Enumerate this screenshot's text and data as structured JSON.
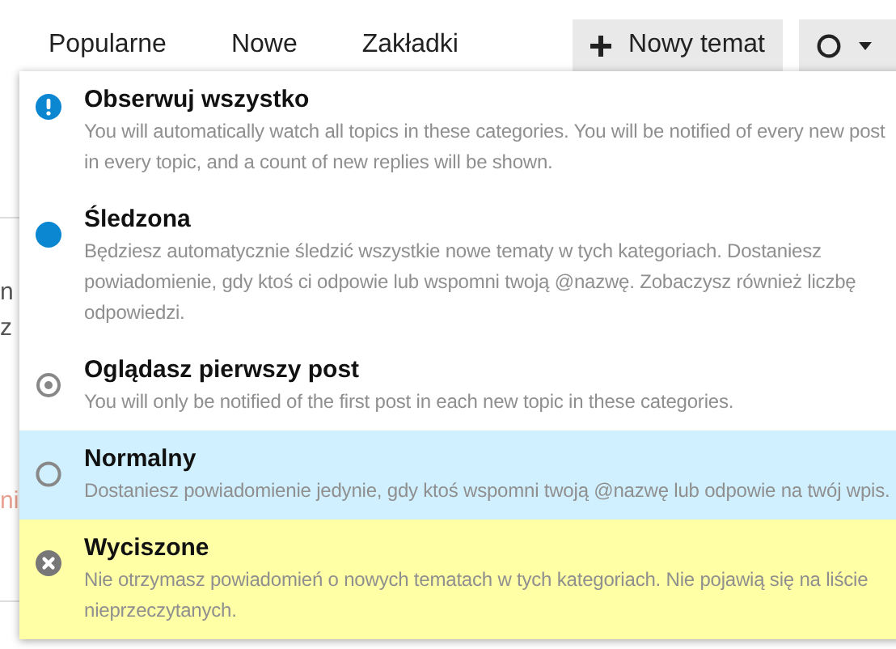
{
  "nav": {
    "links": [
      {
        "label": "Popularne"
      },
      {
        "label": "Nowe"
      },
      {
        "label": "Zakładki"
      }
    ],
    "new_topic_button": {
      "label": "Nowy temat"
    }
  },
  "background": {
    "fragments": [
      {
        "text": "n",
        "kind": "plain"
      },
      {
        "text": "z",
        "kind": "plain"
      },
      {
        "text": "ni",
        "kind": "accent"
      }
    ]
  },
  "dropdown": {
    "items": [
      {
        "kind": "watching",
        "title": "Obserwuj wszystko",
        "description": "You will automatically watch all topics in these categories. You will be notified of every new post in every topic, and a count of new replies will be shown.",
        "selected": false,
        "hovered": false
      },
      {
        "kind": "tracking",
        "title": "Śledzona",
        "description": "Będziesz automatycznie śledzić wszystkie nowe tematy w tych kategoriach. Dostaniesz powiadomienie, gdy ktoś ci odpowie lub wspomni twoją @nazwę. Zobaczysz również liczbę odpowiedzi.",
        "selected": false,
        "hovered": false
      },
      {
        "kind": "first_post",
        "title": "Oglądasz pierwszy post",
        "description": "You will only be notified of the first post in each new topic in these categories.",
        "selected": false,
        "hovered": false
      },
      {
        "kind": "regular",
        "title": "Normalny",
        "description": "Dostaniesz powiadomienie jedynie, gdy ktoś wspomni twoją @nazwę lub odpowie na twój wpis.",
        "selected": true,
        "hovered": false
      },
      {
        "kind": "muted",
        "title": "Wyciszone",
        "description": "Nie otrzymasz powiadomień o nowych tematach w tych kategoriach. Nie pojawią się na liście nieprzeczytanych.",
        "selected": false,
        "hovered": true
      }
    ]
  }
}
